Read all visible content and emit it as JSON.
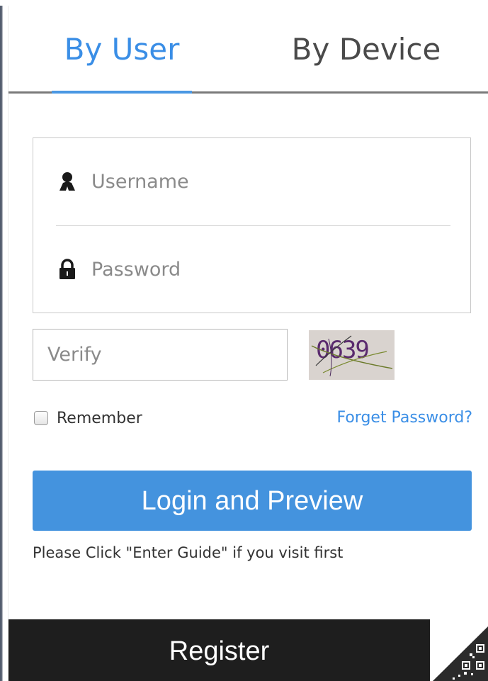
{
  "tabs": {
    "by_user": "By User",
    "by_device": "By Device",
    "active_color": "#3a8ee6"
  },
  "login_form": {
    "username_placeholder": "Username",
    "password_placeholder": "Password",
    "verify_placeholder": "Verify",
    "captcha_text": "0639",
    "remember_label": "Remember",
    "forget_password_link": "Forget Password?",
    "login_button": "Login and Preview",
    "hint": "Please Click \"Enter Guide\" if you visit first"
  },
  "footer": {
    "register_button": "Register"
  },
  "icons": {
    "username": "user-icon",
    "password": "lock-icon",
    "qr": "qr-code-icon"
  },
  "colors": {
    "primary": "#4493de",
    "footer": "#1e1e1e"
  }
}
